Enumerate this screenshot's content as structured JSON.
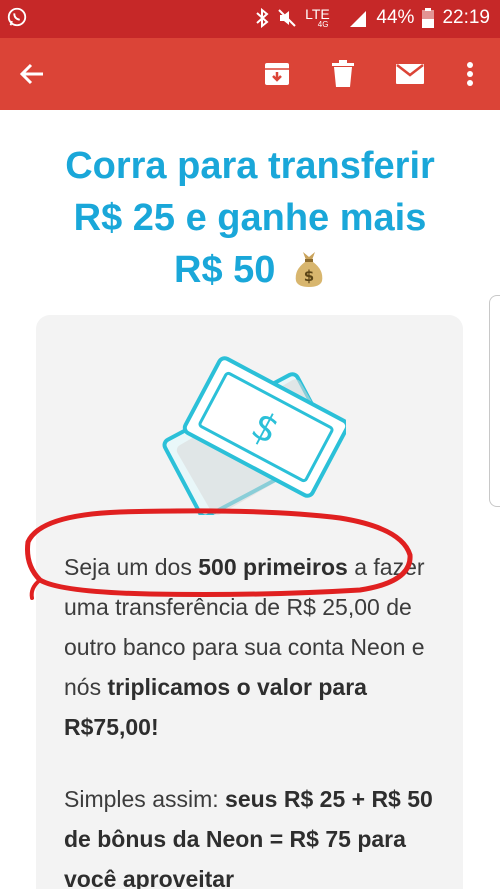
{
  "status_bar": {
    "lte": "LTE",
    "lte_sub": "4G",
    "battery": "44%",
    "time": "22:19",
    "icons": [
      "whatsapp-icon",
      "bluetooth-icon",
      "mute-icon",
      "signal-icon",
      "battery-icon"
    ]
  },
  "toolbar": {
    "icons": [
      "back-arrow-icon",
      "archive-icon",
      "delete-icon",
      "mark-unread-icon",
      "more-vert-icon"
    ]
  },
  "email": {
    "title_line1": "Corra para transferir",
    "title_line2": "R$ 25 e ganhe mais",
    "title_line3": "R$ 50",
    "title_emoji": "money-bag-icon",
    "para1": {
      "t1": "Seja um dos ",
      "b1": "500 primeiros",
      "t2": " a fazer uma transferência de R$ 25,00 de outro banco para sua conta Neon e nós ",
      "b2": "triplicamos o valor para R$75,00!"
    },
    "para2": {
      "t1": "Simples assim: ",
      "b1": "seus R$ 25 + R$ 50 de bônus da Neon = R$",
      "t2": "75 para você aproveitar"
    }
  },
  "colors": {
    "status_bar": "#c62828",
    "app_bar": "#db4437",
    "title": "#1aa7d9",
    "card_bg": "#f3f3f3",
    "illustration": "#2bc0d8",
    "annotation": "#e02020"
  }
}
